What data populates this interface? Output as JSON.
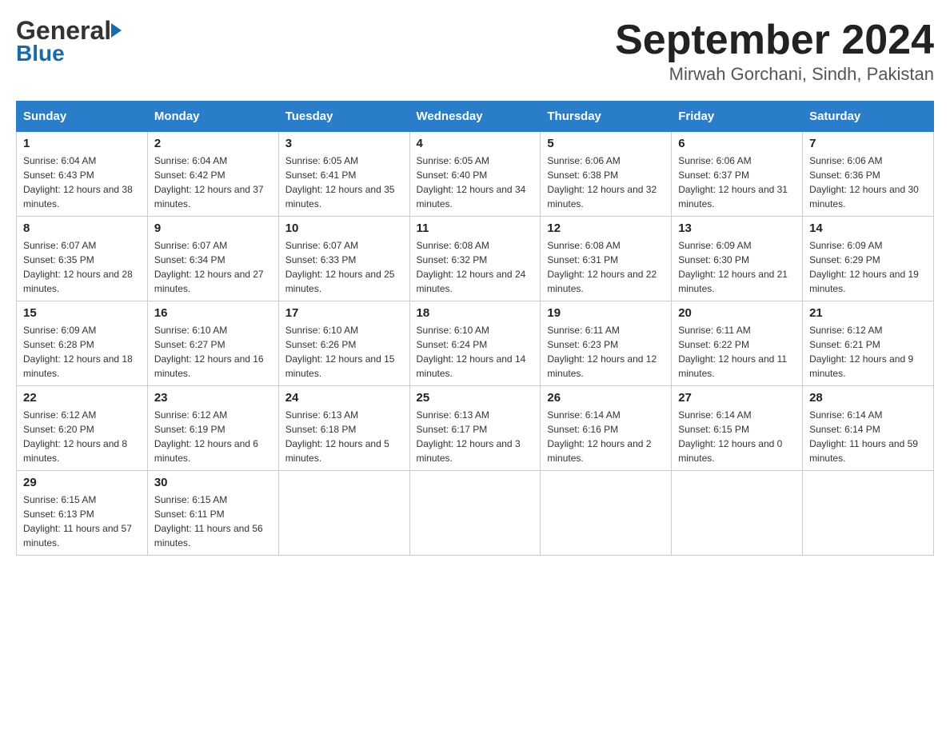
{
  "header": {
    "logo_general": "General",
    "logo_blue": "Blue",
    "month_title": "September 2024",
    "location": "Mirwah Gorchani, Sindh, Pakistan"
  },
  "calendar": {
    "days_of_week": [
      "Sunday",
      "Monday",
      "Tuesday",
      "Wednesday",
      "Thursday",
      "Friday",
      "Saturday"
    ],
    "weeks": [
      [
        {
          "day": "1",
          "sunrise": "Sunrise: 6:04 AM",
          "sunset": "Sunset: 6:43 PM",
          "daylight": "Daylight: 12 hours and 38 minutes."
        },
        {
          "day": "2",
          "sunrise": "Sunrise: 6:04 AM",
          "sunset": "Sunset: 6:42 PM",
          "daylight": "Daylight: 12 hours and 37 minutes."
        },
        {
          "day": "3",
          "sunrise": "Sunrise: 6:05 AM",
          "sunset": "Sunset: 6:41 PM",
          "daylight": "Daylight: 12 hours and 35 minutes."
        },
        {
          "day": "4",
          "sunrise": "Sunrise: 6:05 AM",
          "sunset": "Sunset: 6:40 PM",
          "daylight": "Daylight: 12 hours and 34 minutes."
        },
        {
          "day": "5",
          "sunrise": "Sunrise: 6:06 AM",
          "sunset": "Sunset: 6:38 PM",
          "daylight": "Daylight: 12 hours and 32 minutes."
        },
        {
          "day": "6",
          "sunrise": "Sunrise: 6:06 AM",
          "sunset": "Sunset: 6:37 PM",
          "daylight": "Daylight: 12 hours and 31 minutes."
        },
        {
          "day": "7",
          "sunrise": "Sunrise: 6:06 AM",
          "sunset": "Sunset: 6:36 PM",
          "daylight": "Daylight: 12 hours and 30 minutes."
        }
      ],
      [
        {
          "day": "8",
          "sunrise": "Sunrise: 6:07 AM",
          "sunset": "Sunset: 6:35 PM",
          "daylight": "Daylight: 12 hours and 28 minutes."
        },
        {
          "day": "9",
          "sunrise": "Sunrise: 6:07 AM",
          "sunset": "Sunset: 6:34 PM",
          "daylight": "Daylight: 12 hours and 27 minutes."
        },
        {
          "day": "10",
          "sunrise": "Sunrise: 6:07 AM",
          "sunset": "Sunset: 6:33 PM",
          "daylight": "Daylight: 12 hours and 25 minutes."
        },
        {
          "day": "11",
          "sunrise": "Sunrise: 6:08 AM",
          "sunset": "Sunset: 6:32 PM",
          "daylight": "Daylight: 12 hours and 24 minutes."
        },
        {
          "day": "12",
          "sunrise": "Sunrise: 6:08 AM",
          "sunset": "Sunset: 6:31 PM",
          "daylight": "Daylight: 12 hours and 22 minutes."
        },
        {
          "day": "13",
          "sunrise": "Sunrise: 6:09 AM",
          "sunset": "Sunset: 6:30 PM",
          "daylight": "Daylight: 12 hours and 21 minutes."
        },
        {
          "day": "14",
          "sunrise": "Sunrise: 6:09 AM",
          "sunset": "Sunset: 6:29 PM",
          "daylight": "Daylight: 12 hours and 19 minutes."
        }
      ],
      [
        {
          "day": "15",
          "sunrise": "Sunrise: 6:09 AM",
          "sunset": "Sunset: 6:28 PM",
          "daylight": "Daylight: 12 hours and 18 minutes."
        },
        {
          "day": "16",
          "sunrise": "Sunrise: 6:10 AM",
          "sunset": "Sunset: 6:27 PM",
          "daylight": "Daylight: 12 hours and 16 minutes."
        },
        {
          "day": "17",
          "sunrise": "Sunrise: 6:10 AM",
          "sunset": "Sunset: 6:26 PM",
          "daylight": "Daylight: 12 hours and 15 minutes."
        },
        {
          "day": "18",
          "sunrise": "Sunrise: 6:10 AM",
          "sunset": "Sunset: 6:24 PM",
          "daylight": "Daylight: 12 hours and 14 minutes."
        },
        {
          "day": "19",
          "sunrise": "Sunrise: 6:11 AM",
          "sunset": "Sunset: 6:23 PM",
          "daylight": "Daylight: 12 hours and 12 minutes."
        },
        {
          "day": "20",
          "sunrise": "Sunrise: 6:11 AM",
          "sunset": "Sunset: 6:22 PM",
          "daylight": "Daylight: 12 hours and 11 minutes."
        },
        {
          "day": "21",
          "sunrise": "Sunrise: 6:12 AM",
          "sunset": "Sunset: 6:21 PM",
          "daylight": "Daylight: 12 hours and 9 minutes."
        }
      ],
      [
        {
          "day": "22",
          "sunrise": "Sunrise: 6:12 AM",
          "sunset": "Sunset: 6:20 PM",
          "daylight": "Daylight: 12 hours and 8 minutes."
        },
        {
          "day": "23",
          "sunrise": "Sunrise: 6:12 AM",
          "sunset": "Sunset: 6:19 PM",
          "daylight": "Daylight: 12 hours and 6 minutes."
        },
        {
          "day": "24",
          "sunrise": "Sunrise: 6:13 AM",
          "sunset": "Sunset: 6:18 PM",
          "daylight": "Daylight: 12 hours and 5 minutes."
        },
        {
          "day": "25",
          "sunrise": "Sunrise: 6:13 AM",
          "sunset": "Sunset: 6:17 PM",
          "daylight": "Daylight: 12 hours and 3 minutes."
        },
        {
          "day": "26",
          "sunrise": "Sunrise: 6:14 AM",
          "sunset": "Sunset: 6:16 PM",
          "daylight": "Daylight: 12 hours and 2 minutes."
        },
        {
          "day": "27",
          "sunrise": "Sunrise: 6:14 AM",
          "sunset": "Sunset: 6:15 PM",
          "daylight": "Daylight: 12 hours and 0 minutes."
        },
        {
          "day": "28",
          "sunrise": "Sunrise: 6:14 AM",
          "sunset": "Sunset: 6:14 PM",
          "daylight": "Daylight: 11 hours and 59 minutes."
        }
      ],
      [
        {
          "day": "29",
          "sunrise": "Sunrise: 6:15 AM",
          "sunset": "Sunset: 6:13 PM",
          "daylight": "Daylight: 11 hours and 57 minutes."
        },
        {
          "day": "30",
          "sunrise": "Sunrise: 6:15 AM",
          "sunset": "Sunset: 6:11 PM",
          "daylight": "Daylight: 11 hours and 56 minutes."
        },
        null,
        null,
        null,
        null,
        null
      ]
    ]
  }
}
